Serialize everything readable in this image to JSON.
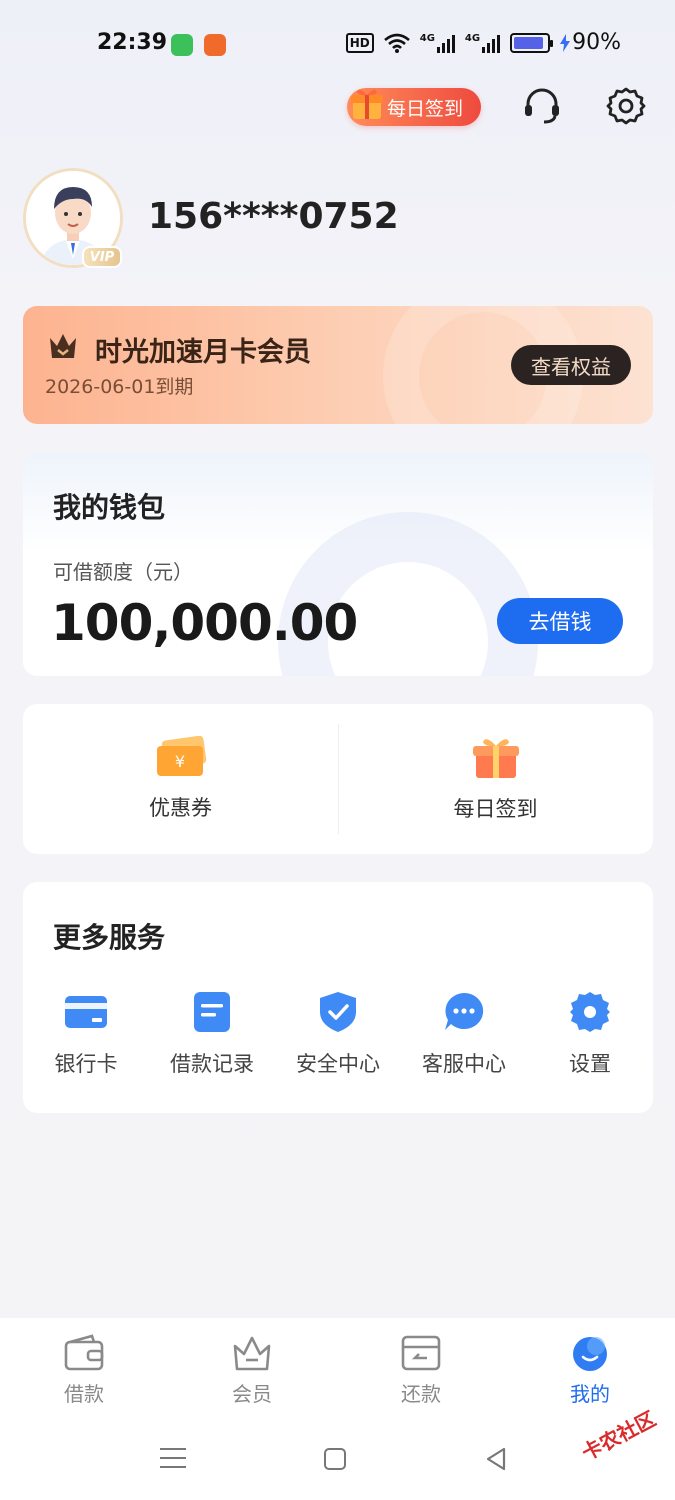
{
  "status_bar": {
    "time": "22:39",
    "hd": "HD",
    "net1": "4G",
    "net2": "4G",
    "battery": "90%",
    "battery_level": 0.9
  },
  "header": {
    "checkin_label": "每日签到"
  },
  "profile": {
    "phone": "156****0752",
    "vip_label": "VIP"
  },
  "membership": {
    "title": "时光加速月卡会员",
    "expiry": "2026-06-01到期",
    "benefits_button": "查看权益"
  },
  "wallet": {
    "title": "我的钱包",
    "credit_label": "可借额度（元）",
    "credit_amount": "100,000.00",
    "borrow_button": "去借钱"
  },
  "quick_actions": [
    {
      "label": "优惠券",
      "icon": "coupon-icon"
    },
    {
      "label": "每日签到",
      "icon": "gift-icon"
    }
  ],
  "services": {
    "title": "更多服务",
    "items": [
      {
        "label": "银行卡",
        "icon": "bank-card-icon"
      },
      {
        "label": "借款记录",
        "icon": "loan-record-icon"
      },
      {
        "label": "安全中心",
        "icon": "shield-icon"
      },
      {
        "label": "客服中心",
        "icon": "chat-icon"
      },
      {
        "label": "设置",
        "icon": "gear-icon"
      }
    ]
  },
  "tabbar": {
    "items": [
      {
        "label": "借款",
        "icon": "wallet-icon",
        "active": false
      },
      {
        "label": "会员",
        "icon": "crown-basket-icon",
        "active": false
      },
      {
        "label": "还款",
        "icon": "repay-icon",
        "active": false
      },
      {
        "label": "我的",
        "icon": "profile-icon",
        "active": true
      }
    ]
  },
  "watermark": "卡农社区",
  "colors": {
    "accent": "#1e6cf0",
    "member_gradient_start": "#fdb38f",
    "checkin_gradient_end": "#ee4a3e"
  }
}
